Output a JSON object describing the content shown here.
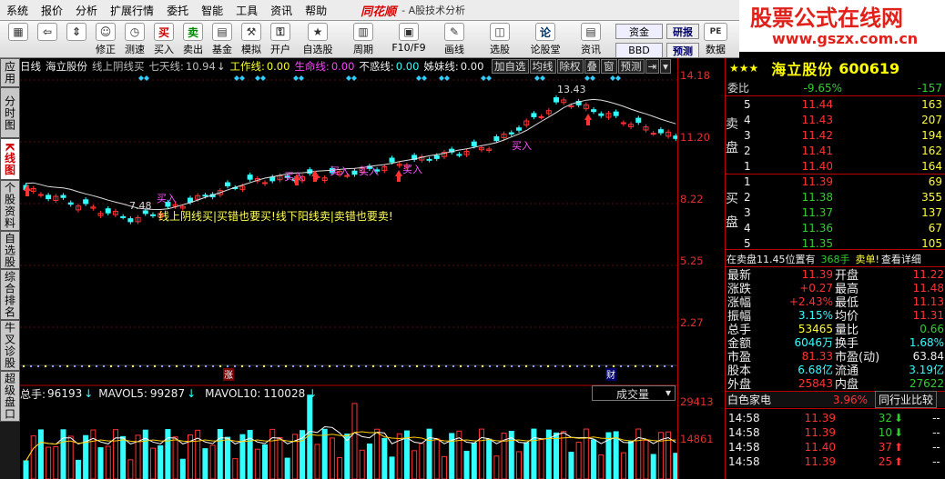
{
  "menu": [
    "系统",
    "报价",
    "分析",
    "扩展行情",
    "委托",
    "智能",
    "工具",
    "资讯",
    "帮助"
  ],
  "app": {
    "logo": "同花顺",
    "title": "- A股技术分析"
  },
  "watermark": {
    "title": "股票公式在线网",
    "url": "www.gszx.com.cn"
  },
  "toolbar": {
    "buttons": [
      {
        "icon": "color-grid-icon",
        "label": ""
      },
      {
        "icon": "back-arrow-icon",
        "label": ""
      },
      {
        "icon": "up-down-arrow-icon",
        "label": ""
      },
      {
        "icon": "revise-icon",
        "label": "修正"
      },
      {
        "icon": "clock-icon",
        "label": "测速"
      },
      {
        "icon": "buy-icon",
        "label": "买入",
        "glyph": "买"
      },
      {
        "icon": "sell-icon",
        "label": "卖出",
        "glyph": "卖"
      },
      {
        "icon": "fund-icon",
        "label": "基金"
      },
      {
        "icon": "hammer-icon",
        "label": "模拟"
      },
      {
        "icon": "lock-icon",
        "label": "开户"
      },
      {
        "icon": "watchlist-icon",
        "label": "自选股"
      },
      {
        "icon": "period-icon",
        "label": "周期"
      },
      {
        "icon": "f10-icon",
        "label": "F10/F9"
      },
      {
        "icon": "draw-line-icon",
        "label": "画线"
      },
      {
        "icon": "stock-select-icon",
        "label": "选股"
      },
      {
        "icon": "forum-icon",
        "label": "论股堂",
        "glyph": "论"
      },
      {
        "icon": "news-icon",
        "label": "资讯"
      }
    ],
    "boxes": [
      "资金",
      "BBD"
    ],
    "boxes2": [
      "研报",
      "预测"
    ],
    "extra": {
      "pe": "PE",
      "data": "数据"
    }
  },
  "sidebar": [
    "应用",
    "分时图",
    "K线图",
    "个股资料",
    "自选股",
    "综合排名",
    "牛叉诊股",
    "超级盘口"
  ],
  "chart_head": {
    "period": "日线",
    "name": "海立股份",
    "line1": "线上阴线买",
    "line2": "七天线:",
    "line2_val": "10.94",
    "work": "工作线:",
    "work_val": "0.00",
    "life": "生命线:",
    "life_val": "0.00",
    "unrest": "不惑线:",
    "unrest_val": "0.00",
    "sister": "姊妹线:",
    "sister_val": "0.00"
  },
  "chart_buttons": [
    "加自选",
    "均线",
    "除权",
    "叠",
    "窗",
    "预测"
  ],
  "annotations": {
    "high": "13.43",
    "low": "7.48",
    "banner": "线上阴线买|买错也要买!线下阳线卖|卖错也要卖!",
    "buy": "买入",
    "marker_zhang": "涨",
    "marker_cai": "财"
  },
  "axis_labels": [
    "14.18",
    "11.20",
    "8.22",
    "5.25",
    "2.27",
    "29413",
    "14861"
  ],
  "volume": {
    "total_label": "总手:",
    "total": "96193",
    "ma5_label": "MAVOL5:",
    "ma5": "99287",
    "ma10_label": "MAVOL10:",
    "ma10": "110028",
    "dropdown": "成交量"
  },
  "quote": {
    "stars": "★★★",
    "name": "海立股份",
    "code": "600619",
    "weibi_label": "委比",
    "weibi": "-9.65%",
    "weicha": "-157",
    "sell_label": "卖盘",
    "buy_label": "买盘",
    "sells": [
      {
        "n": "5",
        "p": "11.44",
        "v": "163"
      },
      {
        "n": "4",
        "p": "11.43",
        "v": "207"
      },
      {
        "n": "3",
        "p": "11.42",
        "v": "194"
      },
      {
        "n": "2",
        "p": "11.41",
        "v": "162"
      },
      {
        "n": "1",
        "p": "11.40",
        "v": "164"
      }
    ],
    "buys": [
      {
        "n": "1",
        "p": "11.39",
        "v": "69"
      },
      {
        "n": "2",
        "p": "11.38",
        "v": "355"
      },
      {
        "n": "3",
        "p": "11.37",
        "v": "137"
      },
      {
        "n": "4",
        "p": "11.36",
        "v": "67"
      },
      {
        "n": "5",
        "p": "11.35",
        "v": "105"
      }
    ],
    "notice_a": "在卖盘11.45位置有",
    "notice_b": "368手",
    "notice_c": "卖单!",
    "notice_d": "查看详细",
    "stats": [
      {
        "l1": "最新",
        "v1": "11.39",
        "l2": "开盘",
        "v2": "11.22"
      },
      {
        "l1": "涨跌",
        "v1": "+0.27",
        "l2": "最高",
        "v2": "11.48"
      },
      {
        "l1": "涨幅",
        "v1": "+2.43%",
        "l2": "最低",
        "v2": "11.13"
      },
      {
        "l1": "振幅",
        "v1": "3.15%",
        "l2": "均价",
        "v2": "11.31"
      },
      {
        "l1": "总手",
        "v1": "53465",
        "l2": "量比",
        "v2": "0.66"
      },
      {
        "l1": "金额",
        "v1": "6046万",
        "l2": "换手",
        "v2": "1.68%"
      },
      {
        "l1": "市盈",
        "v1": "81.33",
        "l2": "市盈(动)",
        "v2": "63.84"
      },
      {
        "l1": "股本",
        "v1": "6.68亿",
        "l2": "流通",
        "v2": "3.19亿"
      },
      {
        "l1": "外盘",
        "v1": "25843",
        "l2": "内盘",
        "v2": "27622"
      }
    ],
    "sector_name": "白色家电",
    "sector_pct": "3.96%",
    "compare": "同行业比较",
    "ticks": [
      {
        "t": "14:58",
        "p": "11.39",
        "v": "32",
        "dir": "down"
      },
      {
        "t": "14:58",
        "p": "11.39",
        "v": "10",
        "dir": "down"
      },
      {
        "t": "14:58",
        "p": "11.40",
        "v": "37",
        "dir": "up"
      },
      {
        "t": "14:58",
        "p": "11.39",
        "v": "25",
        "dir": "up"
      }
    ]
  }
}
